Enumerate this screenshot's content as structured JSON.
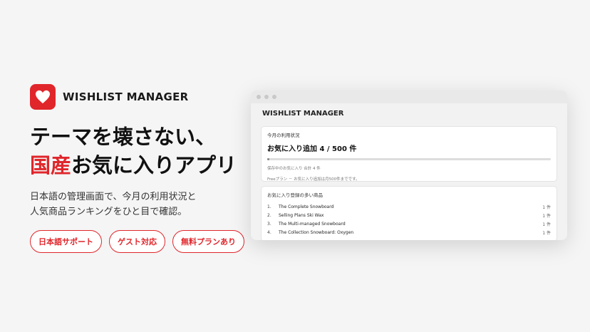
{
  "brand": {
    "name": "WISHLIST MANAGER",
    "logo_icon": "heart-icon",
    "accent": "#e0262b"
  },
  "headline": {
    "line1": "テーマを壊さない、",
    "line2_accent": "国産",
    "line2_rest": "お気に入りアプリ"
  },
  "description": {
    "line1": "日本語の管理画面で、今月の利用状況と",
    "line2": "人気商品ランキングをひと目で確認。"
  },
  "pills": [
    "日本語サポート",
    "ゲスト対応",
    "無料プランあり"
  ],
  "app": {
    "title": "WISHLIST MANAGER",
    "usage": {
      "heading": "今月の利用状況",
      "value_text": "お気に入り追加 4 / 500 件",
      "progress": 0.008,
      "saved_text": "保存中のお気に入り 合計 4 件",
      "note": "Freeプラン － お気に入り追加は月500件までです。"
    },
    "ranking": {
      "heading": "お気に入り登録の多い商品",
      "items": [
        {
          "no": "1.",
          "name": "The Complete Snowboard",
          "count": "1 件"
        },
        {
          "no": "2.",
          "name": "Selling Plans Ski Wax",
          "count": "1 件"
        },
        {
          "no": "3.",
          "name": "The Multi-managed Snowboard",
          "count": "1 件"
        },
        {
          "no": "4.",
          "name": "The Collection Snowboard: Oxygen",
          "count": "1 件"
        }
      ]
    }
  }
}
